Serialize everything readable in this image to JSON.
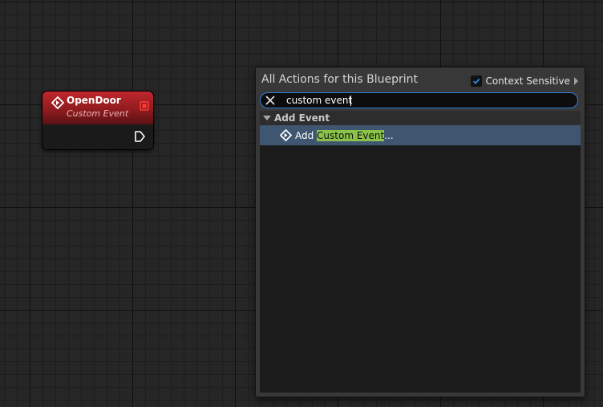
{
  "node": {
    "title": "OpenDoor",
    "subtitle": "Custom Event",
    "icon": "event-diamond-icon",
    "header_color": "#b3262b"
  },
  "menu": {
    "title": "All Actions for this Blueprint",
    "context_sensitive": {
      "label": "Context Sensitive",
      "checked": true
    },
    "search": {
      "value": "custom event"
    },
    "categories": [
      {
        "label": "Add Event",
        "expanded": true,
        "items": [
          {
            "prefix": "Add ",
            "match": "Custom Event",
            "suffix": "...",
            "selected": true
          }
        ]
      }
    ]
  },
  "colors": {
    "selection": "#3f5671",
    "highlight": "#8bc34a",
    "focus_border": "#2e7fd9"
  }
}
